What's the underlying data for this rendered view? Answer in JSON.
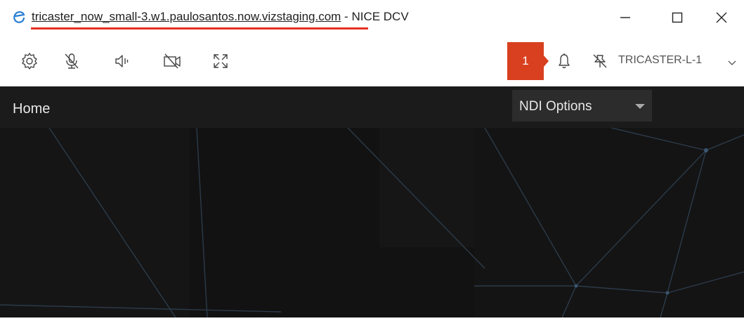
{
  "window": {
    "url": "tricaster_now_small-3.w1.paulosantos.now.vizstaging.com",
    "separator": " - ",
    "app_name": "NICE DCV",
    "browser_icon": "edge-icon",
    "controls": [
      "minimize-icon",
      "maximize-icon",
      "close-icon"
    ]
  },
  "toolbar": {
    "icons": [
      "gear-icon",
      "microphone-muted-icon",
      "speaker-icon",
      "camera-off-icon",
      "fullscreen-icon"
    ],
    "notification_count": "1",
    "notification_icon": "bell-icon",
    "user_icon": "pin-off-icon",
    "server_name": "TRICASTER-L-1",
    "dropdown_icon": "chevron-down-icon"
  },
  "app": {
    "title": "Home",
    "ndi_select": "NDI Options"
  },
  "colors": {
    "annotation": "#e53023",
    "badge": "#d8401f",
    "app_background": "#1b1b1b",
    "canvas": "#121212",
    "network_lines": "#2c3b4a"
  }
}
